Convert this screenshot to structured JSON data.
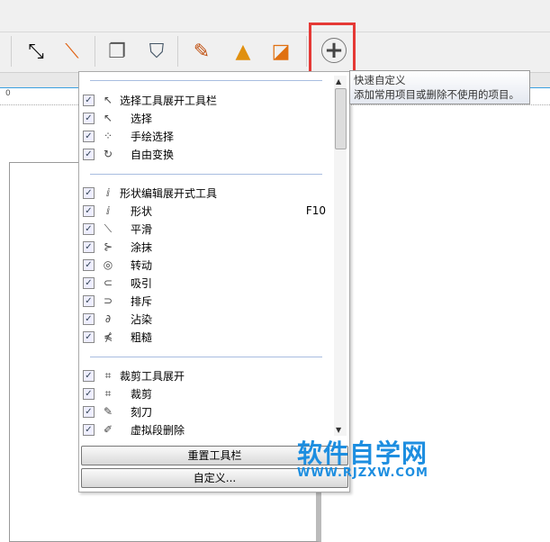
{
  "toolbar": {
    "icons": [
      "dimension-icon",
      "connector-icon",
      "drop-shadow-icon",
      "transparency-icon",
      "eyedropper-icon",
      "fill-icon",
      "smart-fill-icon"
    ],
    "quick_customize_icon": "plus-circle-icon"
  },
  "ruler": {
    "zero": "0"
  },
  "tooltip": {
    "title": "快速自定义",
    "desc": "添加常用项目或删除不使用的项目。"
  },
  "menu": {
    "groups": [
      {
        "items": [
          {
            "label": "选择工具展开工具栏",
            "icon": "pointer-icon",
            "sub": false
          },
          {
            "label": "选择",
            "icon": "pointer-icon",
            "sub": true
          },
          {
            "label": "手绘选择",
            "icon": "freehand-select-icon",
            "sub": true
          },
          {
            "label": "自由变换",
            "icon": "free-transform-icon",
            "sub": true
          }
        ]
      },
      {
        "items": [
          {
            "label": "形状编辑展开式工具",
            "icon": "shape-icon",
            "sub": false
          },
          {
            "label": "形状",
            "icon": "shape-icon",
            "sub": true,
            "key": "F10"
          },
          {
            "label": "平滑",
            "icon": "smooth-icon",
            "sub": true
          },
          {
            "label": "涂抹",
            "icon": "smear-icon",
            "sub": true
          },
          {
            "label": "转动",
            "icon": "twirl-icon",
            "sub": true
          },
          {
            "label": "吸引",
            "icon": "attract-icon",
            "sub": true
          },
          {
            "label": "排斥",
            "icon": "repel-icon",
            "sub": true
          },
          {
            "label": "沾染",
            "icon": "smudge-icon",
            "sub": true
          },
          {
            "label": "粗糙",
            "icon": "roughen-icon",
            "sub": true
          }
        ]
      },
      {
        "items": [
          {
            "label": "裁剪工具展开",
            "icon": "crop-icon",
            "sub": false
          },
          {
            "label": "裁剪",
            "icon": "crop-icon",
            "sub": true
          },
          {
            "label": "刻刀",
            "icon": "knife-icon",
            "sub": true
          },
          {
            "label": "虚拟段删除",
            "icon": "virtual-segment-delete-icon",
            "sub": true
          }
        ]
      }
    ],
    "reset_button": "重置工具栏",
    "customize_button": "自定义..."
  },
  "watermark": {
    "title": "软件自学网",
    "url": "WWW.RJZXW.COM"
  }
}
